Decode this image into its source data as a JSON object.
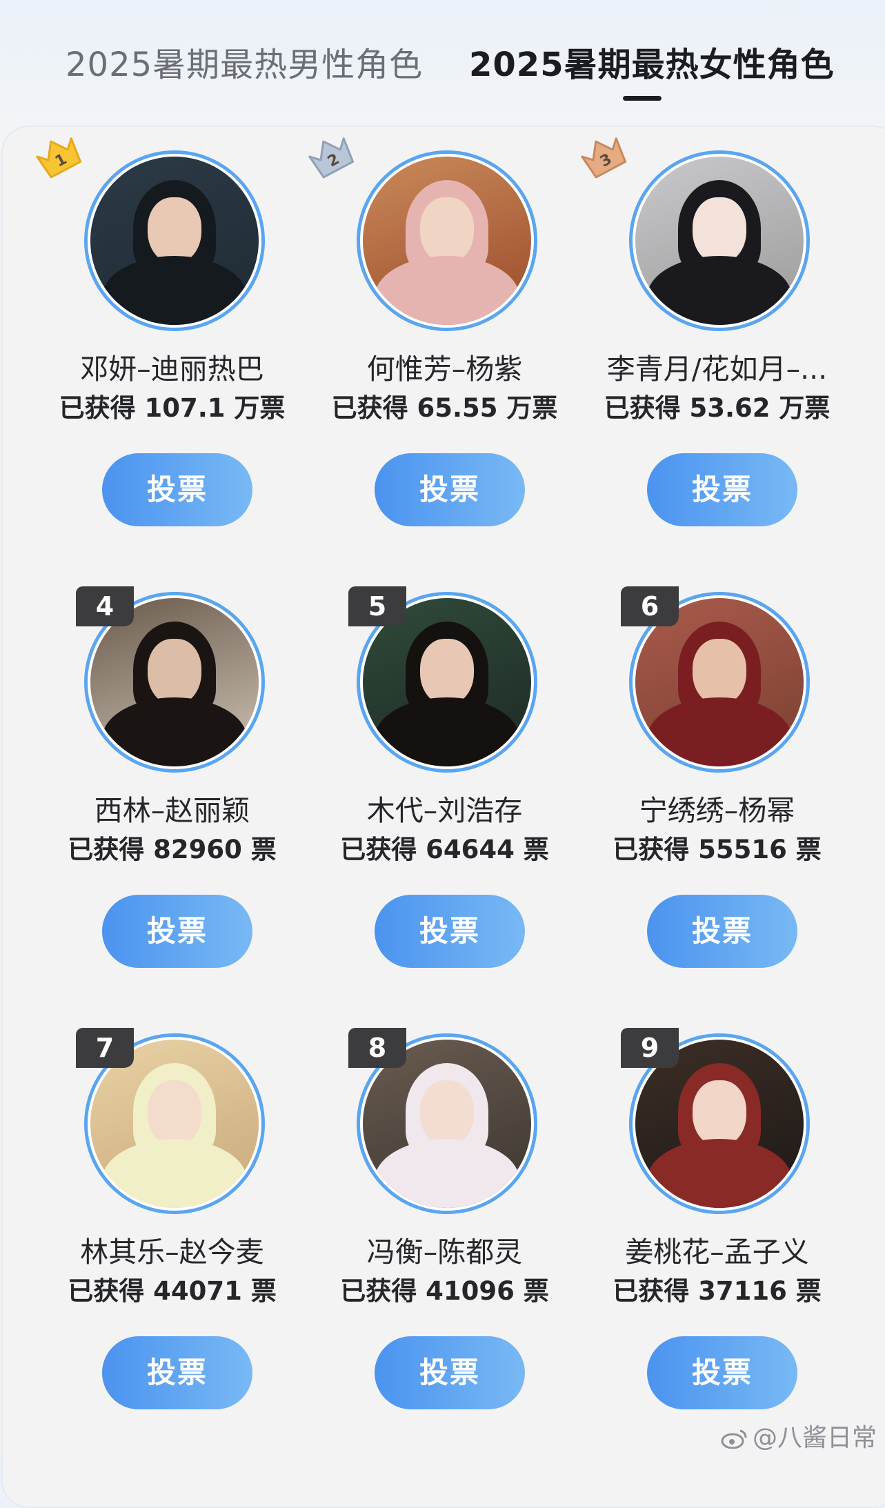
{
  "tabs": [
    {
      "label": "2025暑期最热男性角色",
      "active": false
    },
    {
      "label": "2025暑期最热女性角色",
      "active": true
    }
  ],
  "accent_color": "#5aa5f0",
  "button_gradient": [
    "#4b93f0",
    "#78b9f4"
  ],
  "characters": [
    {
      "rank": "1",
      "name": "邓妍–迪丽热巴",
      "votes": "已获得 107.1 万票",
      "button": "投票",
      "medal": "gold",
      "palette": [
        "#1f2a33",
        "#2c3a47",
        "#e9c8b4",
        "#151a1f"
      ]
    },
    {
      "rank": "2",
      "name": "何惟芳–杨紫",
      "votes": "已获得 65.55 万票",
      "button": "投票",
      "medal": "silver",
      "palette": [
        "#9a4a2a",
        "#c98a5a",
        "#f0d4c4",
        "#e6b4b0"
      ]
    },
    {
      "rank": "3",
      "name": "李青月/花如月–...",
      "votes": "已获得 53.62 万票",
      "button": "投票",
      "medal": "bronze",
      "palette": [
        "#9a9a9a",
        "#c9c9cc",
        "#f3e2da",
        "#1a1a1e"
      ]
    },
    {
      "rank": "4",
      "name": "西林–赵丽颖",
      "votes": "已获得 82960 票",
      "button": "投票",
      "medal": "",
      "palette": [
        "#cfc5b8",
        "#6a5a4c",
        "#dcbda8",
        "#1a1412"
      ]
    },
    {
      "rank": "5",
      "name": "木代–刘浩存",
      "votes": "已获得 64644 票",
      "button": "投票",
      "medal": "",
      "palette": [
        "#1e2a24",
        "#2f4a3a",
        "#e8c8b4",
        "#14110f"
      ]
    },
    {
      "rank": "6",
      "name": "宁绣绣–杨幂",
      "votes": "已获得 55516 票",
      "button": "投票",
      "medal": "",
      "palette": [
        "#7a4030",
        "#a95a4c",
        "#e7c0aa",
        "#7a1e22"
      ]
    },
    {
      "rank": "7",
      "name": "林其乐–赵今麦",
      "votes": "已获得 44071 票",
      "button": "投票",
      "medal": "",
      "palette": [
        "#c9a87a",
        "#e8d2a4",
        "#f3dccb",
        "#f1efc8"
      ]
    },
    {
      "rank": "8",
      "name": "冯衡–陈都灵",
      "votes": "已获得 41096 票",
      "button": "投票",
      "medal": "",
      "palette": [
        "#3a3530",
        "#6a5c50",
        "#f3ddd2",
        "#f0e8ec"
      ]
    },
    {
      "rank": "9",
      "name": "姜桃花–孟子义",
      "votes": "已获得 37116 票",
      "button": "投票",
      "medal": "",
      "palette": [
        "#1c1816",
        "#3d2e26",
        "#f1d6c8",
        "#8a2a26"
      ]
    }
  ],
  "watermark": "@八酱日常"
}
